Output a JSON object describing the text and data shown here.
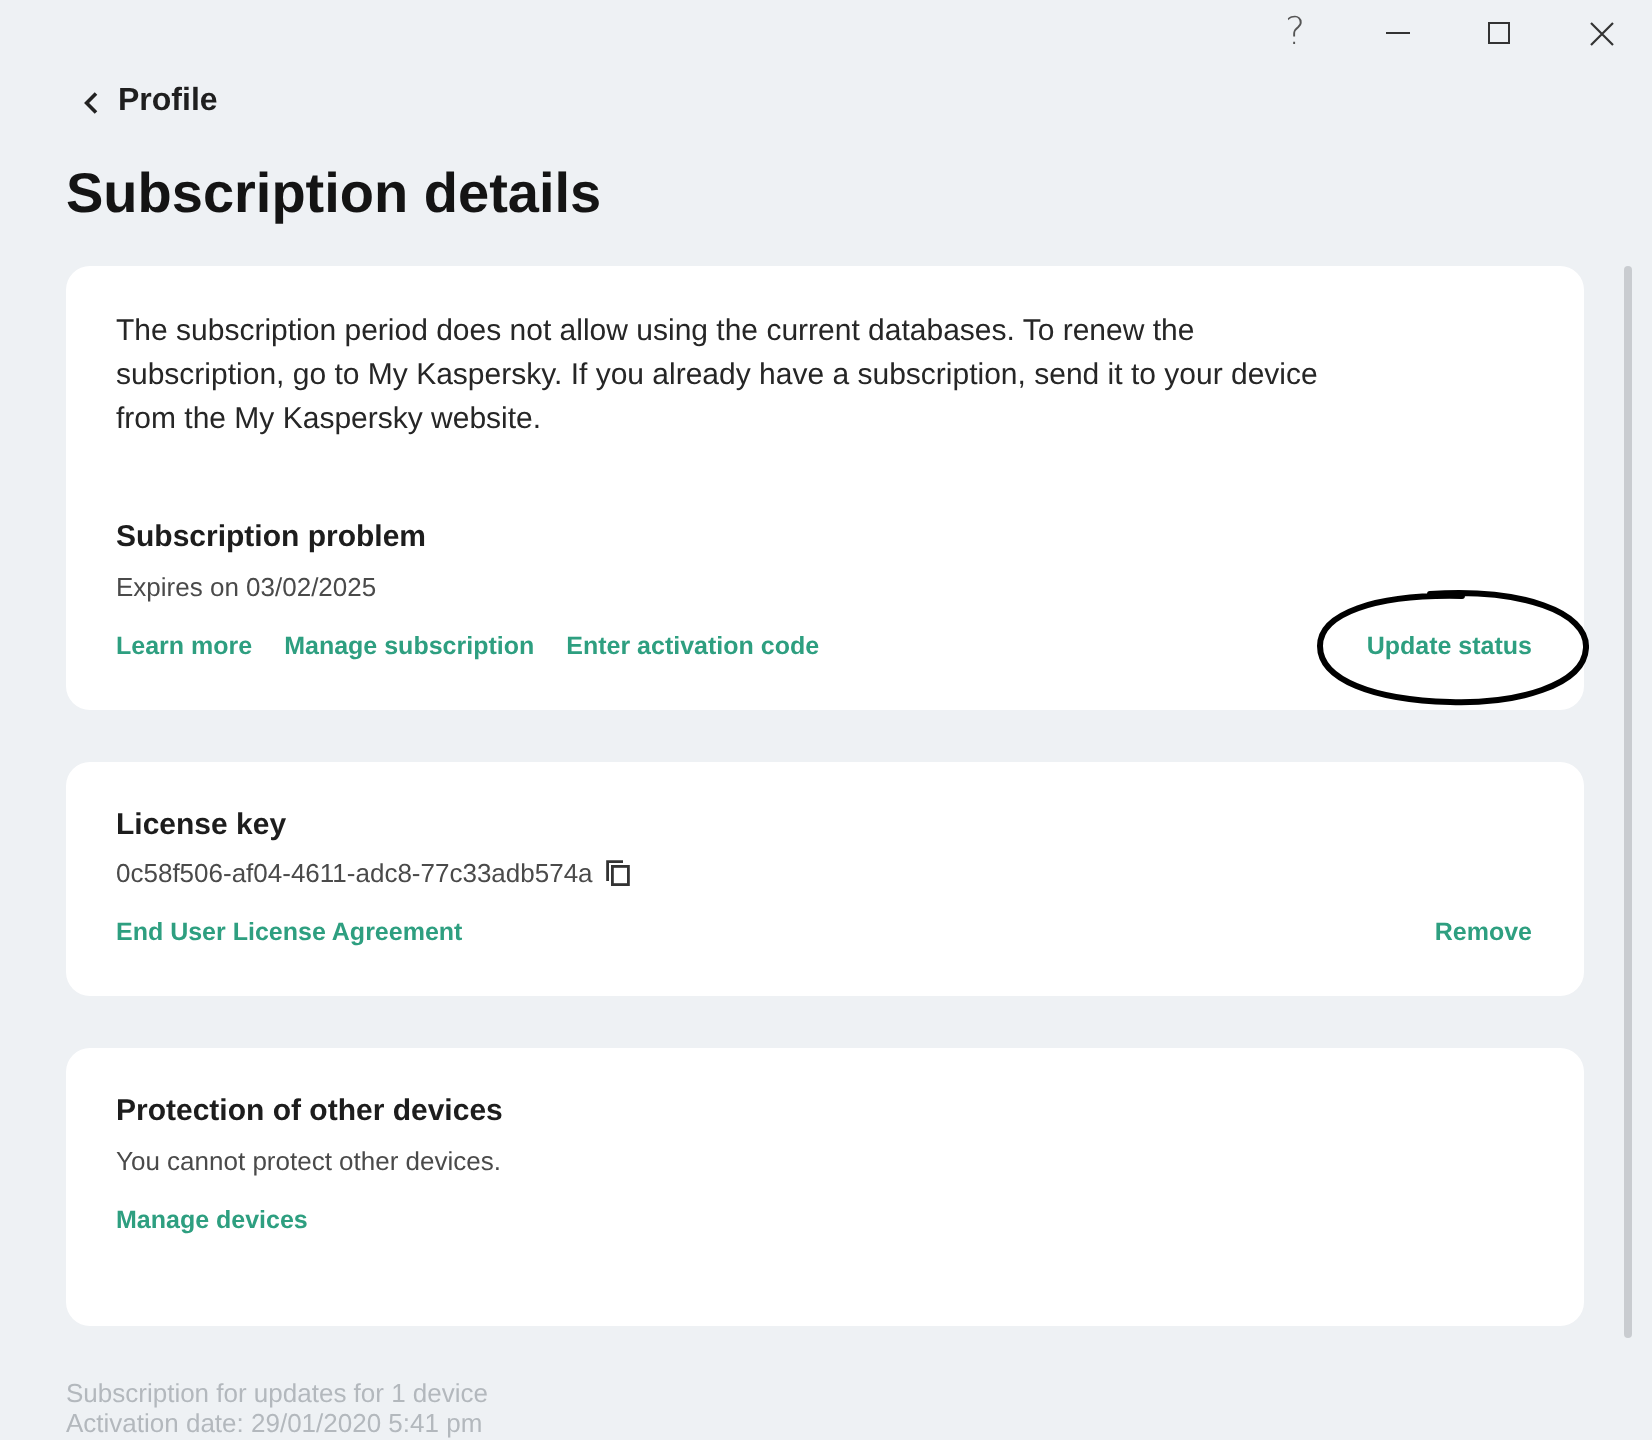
{
  "window": {
    "controls": [
      {
        "kind": "help",
        "label": "?"
      },
      {
        "kind": "minimize"
      },
      {
        "kind": "maximize"
      },
      {
        "kind": "close"
      }
    ]
  },
  "back_link": {
    "label": "Profile"
  },
  "title": "Subscription details",
  "cards": [
    {
      "message": "The subscription period does not allow using the current databases. To renew the subscription, go to My Kaspersky. If you already have a subscription, send it to your device from the My Kaspersky website.",
      "heading": "Subscription problem",
      "detail": "Expires on 03/02/2025",
      "links": [
        {
          "label": "Learn more",
          "circled": false
        },
        {
          "label": "Manage subscription",
          "circled": false
        },
        {
          "label": "Enter activation code",
          "circled": false
        }
      ],
      "end_link": {
        "label": "Update status",
        "circled": true
      }
    },
    {
      "heading": "License key",
      "license_key": "0c58f506-af04-4611-adc8-77c33adb574a",
      "links": [
        {
          "label": "End User License Agreement",
          "circled": false
        }
      ],
      "end_link": {
        "label": "Remove",
        "circled": false
      }
    },
    {
      "heading": "Protection of other devices",
      "detail": "You cannot protect other devices.",
      "links": [
        {
          "label": "Manage devices",
          "circled": false
        }
      ]
    }
  ],
  "footer": [
    "Subscription for updates for 1 device",
    "Activation date: 29/01/2020 5:41 pm"
  ]
}
